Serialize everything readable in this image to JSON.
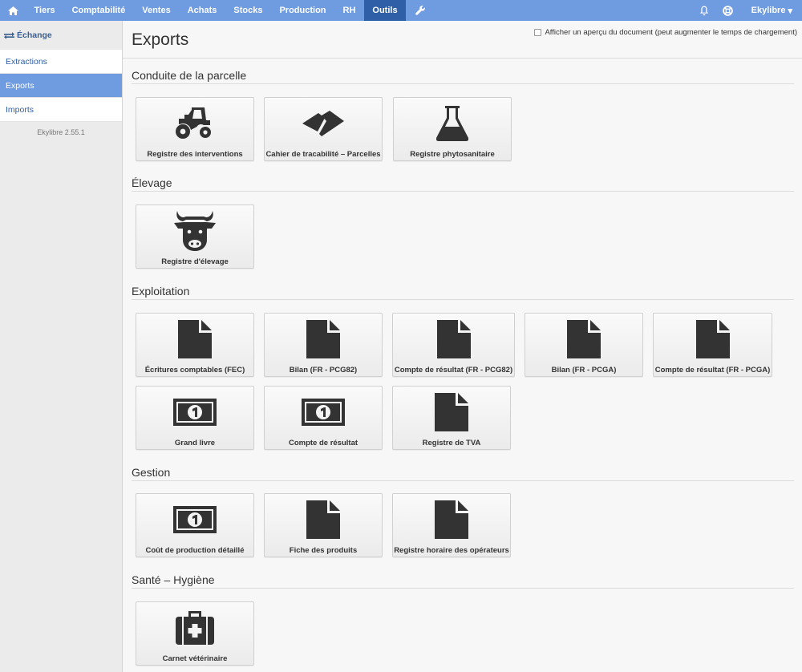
{
  "nav": {
    "items": [
      {
        "label": "Tiers"
      },
      {
        "label": "Comptabilité"
      },
      {
        "label": "Ventes"
      },
      {
        "label": "Achats"
      },
      {
        "label": "Stocks"
      },
      {
        "label": "Production"
      },
      {
        "label": "RH"
      },
      {
        "label": "Outils",
        "active": true
      }
    ],
    "user": "Ekylibre",
    "user_caret": "▾",
    "icons": [
      "home-icon",
      "wrench-icon",
      "bell-icon",
      "help-icon"
    ]
  },
  "sidebar": {
    "header": "Échange",
    "header_icon": "exchange-icon",
    "items": [
      {
        "label": "Extractions"
      },
      {
        "label": "Exports",
        "active": true
      },
      {
        "label": "Imports"
      }
    ],
    "version": "Ekylibre 2.55.1"
  },
  "page": {
    "title": "Exports",
    "preview_label": "Afficher un aperçu du document (peut augmenter le temps de chargement)",
    "preview_checked": false
  },
  "sections": [
    {
      "title": "Conduite de la parcelle",
      "tiles": [
        {
          "label": "Registre des interventions",
          "icon": "tractor-icon"
        },
        {
          "label": "Cahier de tracabilité – Parcelles",
          "icon": "land-parcel-icon"
        },
        {
          "label": "Registre phytosanitaire",
          "icon": "flask-icon"
        }
      ]
    },
    {
      "title": "Élevage",
      "tiles": [
        {
          "label": "Registre d'élevage",
          "icon": "cow-icon"
        }
      ]
    },
    {
      "title": "Exploitation",
      "tiles": [
        {
          "label": "Écritures comptables (FEC)",
          "icon": "file-icon"
        },
        {
          "label": "Bilan (FR - PCG82)",
          "icon": "file-icon"
        },
        {
          "label": "Compte de résultat (FR - PCG82)",
          "icon": "file-icon"
        },
        {
          "label": "Bilan (FR - PCGA)",
          "icon": "file-icon"
        },
        {
          "label": "Compte de résultat (FR - PCGA)",
          "icon": "file-icon"
        },
        {
          "label": "Grand livre",
          "icon": "banknote-icon"
        },
        {
          "label": "Compte de résultat",
          "icon": "banknote-icon"
        },
        {
          "label": "Registre de TVA",
          "icon": "file-icon"
        }
      ]
    },
    {
      "title": "Gestion",
      "tiles": [
        {
          "label": "Coût de production détaillé",
          "icon": "banknote-icon"
        },
        {
          "label": "Fiche des produits",
          "icon": "file-icon"
        },
        {
          "label": "Registre horaire des opérateurs",
          "icon": "file-icon"
        }
      ]
    },
    {
      "title": "Santé – Hygiène",
      "tiles": [
        {
          "label": "Carnet vétérinaire",
          "icon": "medkit-icon"
        }
      ]
    }
  ],
  "colors": {
    "nav_bg": "#6f9be1",
    "nav_active": "#2f5fa6",
    "link": "#2f5fa6",
    "icon": "#333333"
  }
}
